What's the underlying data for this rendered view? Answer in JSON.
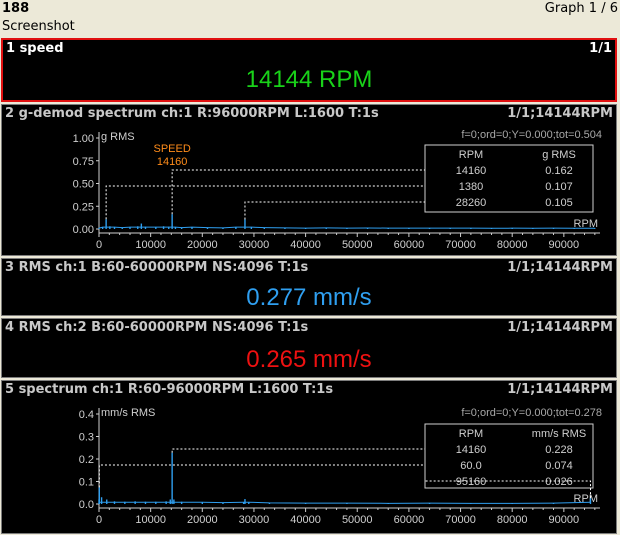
{
  "header": {
    "number": "188",
    "subtitle": "Screenshot",
    "graph_label": "Graph 1 / 6"
  },
  "colors": {
    "green": "#19d219",
    "blue": "#2f9ff0",
    "red": "#ee1111",
    "orange": "#ff8c1a",
    "spectrum": "#2f9ff0",
    "selected_border": "#e01010"
  },
  "panels": {
    "speed": {
      "title": "1 speed",
      "right": "1/1",
      "value": "14144 RPM"
    },
    "gdemod": {
      "title": "2 g-demod spectrum ch:1 R:96000RPM L:1600 T:1s",
      "right": "1/1;14144RPM",
      "stats": "f=0;ord=0;Y=0.000;tot=0.504",
      "table_headers": [
        "RPM",
        "g RMS"
      ],
      "table_rows": [
        [
          "14160",
          "0.162"
        ],
        [
          "1380",
          "0.107"
        ],
        [
          "28260",
          "0.105"
        ]
      ]
    },
    "rms1": {
      "title": "3 RMS ch:1 B:60-60000RPM NS:4096 T:1s",
      "right": "1/1;14144RPM",
      "value": "0.277 mm/s"
    },
    "rms2": {
      "title": "4 RMS ch:2 B:60-60000RPM NS:4096 T:1s",
      "right": "1/1;14144RPM",
      "value": "0.265 mm/s"
    },
    "spectrum": {
      "title": "5 spectrum ch:1 R:60-96000RPM L:1600 T:1s",
      "right": "1/1;14144RPM",
      "stats": "f=0;ord=0;Y=0.000;tot=0.278",
      "table_headers": [
        "RPM",
        "mm/s RMS"
      ],
      "table_rows": [
        [
          "14160",
          "0.228"
        ],
        [
          "60.0",
          "0.074"
        ],
        [
          "95160",
          "0.026"
        ]
      ]
    }
  },
  "chart_data": [
    {
      "type": "line",
      "title": "2 g-demod spectrum ch:1 R:96000RPM L:1600 T:1s",
      "ylabel": "g RMS",
      "xlabel": "RPM",
      "xlim": [
        0,
        97000
      ],
      "ylim": [
        0,
        1.0
      ],
      "x_ticks": [
        0,
        10000,
        20000,
        30000,
        40000,
        50000,
        60000,
        70000,
        80000,
        90000
      ],
      "x_tick_labels": [
        "0",
        "10000",
        "20000",
        "30000",
        "40000",
        "50000",
        "60000",
        "70000",
        "80000",
        "90000"
      ],
      "y_ticks": [
        0,
        0.25,
        0.5,
        0.75,
        1.0
      ],
      "y_tick_labels": [
        "0.00",
        "0.25",
        "0.50",
        "0.75",
        "1.00"
      ],
      "grid": false,
      "series": [
        {
          "color": "#2f9ff0",
          "x": [
            0,
            700,
            1380,
            2100,
            3000,
            4500,
            6000,
            7500,
            8200,
            9000,
            11000,
            12500,
            13500,
            14160,
            14800,
            16000,
            18000,
            21000,
            24000,
            26500,
            28260,
            29500,
            32000,
            36000,
            40000,
            44000,
            48000,
            52000,
            56000,
            60000,
            64000,
            68000,
            72000,
            76000,
            80000,
            84000,
            88000,
            92000,
            96000
          ],
          "y": [
            0.01,
            0.02,
            0.107,
            0.03,
            0.02,
            0.015,
            0.02,
            0.03,
            0.06,
            0.025,
            0.02,
            0.03,
            0.025,
            0.162,
            0.02,
            0.015,
            0.02,
            0.015,
            0.012,
            0.02,
            0.105,
            0.02,
            0.015,
            0.012,
            0.01,
            0.012,
            0.01,
            0.011,
            0.01,
            0.009,
            0.01,
            0.009,
            0.01,
            0.008,
            0.009,
            0.008,
            0.009,
            0.008,
            0.008
          ]
        }
      ],
      "annotations": [
        {
          "text": "SPEED",
          "x": 14160,
          "color": "#ff8c1a"
        },
        {
          "text": "14160",
          "x": 14160,
          "color": "#ff8c1a"
        }
      ],
      "markers": [
        {
          "x": 14160,
          "y": 0.162
        },
        {
          "x": 1380,
          "y": 0.107
        },
        {
          "x": 28260,
          "y": 0.105
        }
      ]
    },
    {
      "type": "line",
      "title": "5 spectrum ch:1 R:60-96000RPM L:1600 T:1s",
      "ylabel": "mm/s RMS",
      "xlabel": "RPM",
      "xlim": [
        0,
        97000
      ],
      "ylim": [
        0,
        0.4
      ],
      "x_ticks": [
        0,
        10000,
        20000,
        30000,
        40000,
        50000,
        60000,
        70000,
        80000,
        90000
      ],
      "x_tick_labels": [
        "0",
        "10000",
        "20000",
        "30000",
        "40000",
        "50000",
        "60000",
        "70000",
        "80000",
        "90000"
      ],
      "y_ticks": [
        0,
        0.1,
        0.2,
        0.3,
        0.4
      ],
      "y_tick_labels": [
        "0.0",
        "0.1",
        "0.2",
        "0.3",
        "0.4"
      ],
      "grid": false,
      "series": [
        {
          "color": "#2f9ff0",
          "x": [
            0,
            60,
            500,
            1500,
            3000,
            5000,
            7000,
            9000,
            11000,
            13000,
            13800,
            14160,
            14500,
            16000,
            20000,
            24000,
            28000,
            28260,
            29000,
            33000,
            40000,
            48000,
            56000,
            64000,
            72000,
            80000,
            88000,
            95160
          ],
          "y": [
            0.02,
            0.074,
            0.03,
            0.02,
            0.012,
            0.01,
            0.012,
            0.01,
            0.01,
            0.012,
            0.02,
            0.228,
            0.02,
            0.01,
            0.008,
            0.006,
            0.008,
            0.022,
            0.008,
            0.005,
            0.004,
            0.004,
            0.003,
            0.004,
            0.003,
            0.003,
            0.004,
            0.026
          ]
        }
      ],
      "markers": [
        {
          "x": 14160,
          "y": 0.228
        },
        {
          "x": 60,
          "y": 0.074
        },
        {
          "x": 95160,
          "y": 0.026
        }
      ]
    }
  ]
}
